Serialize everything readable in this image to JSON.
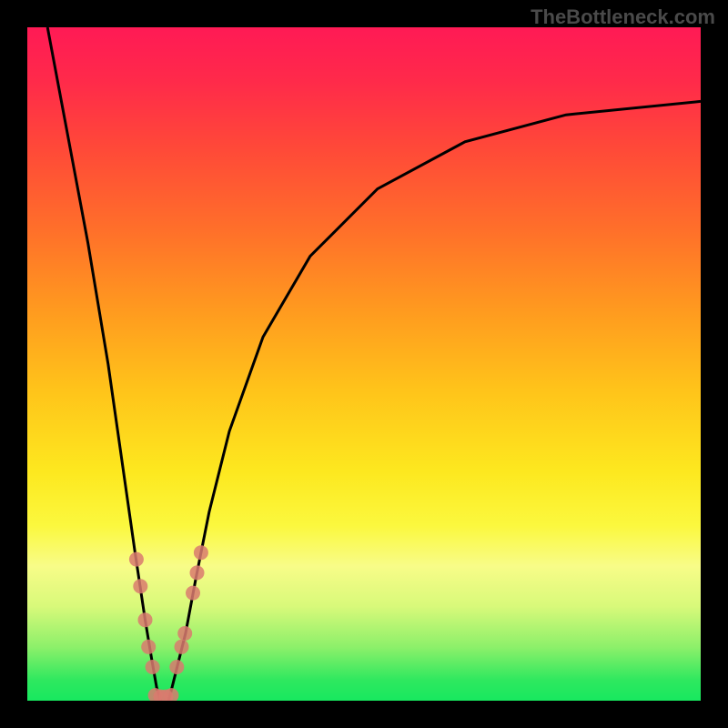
{
  "watermark": "TheBottleneck.com",
  "chart_data": {
    "type": "line",
    "title": "",
    "xlabel": "",
    "ylabel": "",
    "xlim": [
      0,
      100
    ],
    "ylim": [
      0,
      100
    ],
    "series": [
      {
        "name": "left-branch",
        "x": [
          3,
          6,
          9,
          12,
          14,
          16,
          17.5,
          18.5,
          19.2,
          19.8
        ],
        "y": [
          100,
          84,
          68,
          50,
          36,
          22,
          12,
          6,
          2,
          0
        ]
      },
      {
        "name": "right-branch",
        "x": [
          21,
          22,
          23.5,
          25,
          27,
          30,
          35,
          42,
          52,
          65,
          80,
          100
        ],
        "y": [
          0,
          4,
          10,
          18,
          28,
          40,
          54,
          66,
          76,
          83,
          87,
          89
        ]
      }
    ],
    "markers": [
      {
        "series": "left-branch",
        "cx": 16.2,
        "cy": 21
      },
      {
        "series": "left-branch",
        "cx": 16.8,
        "cy": 17
      },
      {
        "series": "left-branch",
        "cx": 17.5,
        "cy": 12
      },
      {
        "series": "left-branch",
        "cx": 18.0,
        "cy": 8
      },
      {
        "series": "left-branch",
        "cx": 18.6,
        "cy": 5
      },
      {
        "series": "bottom",
        "cx": 19.0,
        "cy": 0.8
      },
      {
        "series": "bottom",
        "cx": 19.8,
        "cy": 0.6
      },
      {
        "series": "bottom",
        "cx": 20.6,
        "cy": 0.6
      },
      {
        "series": "bottom",
        "cx": 21.4,
        "cy": 0.8
      },
      {
        "series": "right-branch",
        "cx": 22.2,
        "cy": 5
      },
      {
        "series": "right-branch",
        "cx": 22.9,
        "cy": 8
      },
      {
        "series": "right-branch",
        "cx": 23.4,
        "cy": 10
      },
      {
        "series": "right-branch",
        "cx": 24.6,
        "cy": 16
      },
      {
        "series": "right-branch",
        "cx": 25.2,
        "cy": 19
      },
      {
        "series": "right-branch",
        "cx": 25.8,
        "cy": 22
      }
    ],
    "marker_radius_px": 8,
    "colors": {
      "curve": "#000000",
      "marker": "#d97a6f",
      "gradient_top": "#ff1a55",
      "gradient_bottom": "#18e85f"
    }
  }
}
